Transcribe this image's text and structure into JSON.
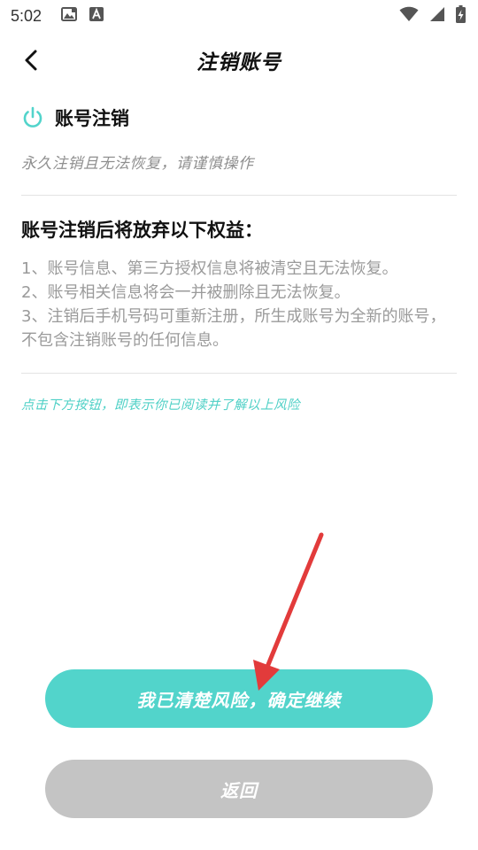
{
  "status_bar": {
    "time": "5:02",
    "left_icons": [
      "image-icon",
      "font-a-icon"
    ],
    "right_icons": [
      "wifi-icon",
      "signal-icon",
      "battery-charging-icon"
    ]
  },
  "header": {
    "title": "注销账号",
    "back_icon": "chevron-left-icon"
  },
  "section": {
    "icon": "power-icon",
    "title": "账号注销",
    "subtitle": "永久注销且无法恢复，请谨慎操作"
  },
  "rights": {
    "title": "账号注销后将放弃以下权益：",
    "items": [
      "1、账号信息、第三方授权信息将被清空且无法恢复。",
      "2、账号相关信息将会一并被删除且无法恢复。",
      "3、注销后手机号码可重新注册，所生成账号为全新的账号，不包含注销账号的任何信息。"
    ]
  },
  "notice": "点击下方按钮，即表示你已阅读并了解以上风险",
  "buttons": {
    "confirm_label": "我已清楚风险，确定继续",
    "back_label": "返回"
  },
  "colors": {
    "accent": "#52d4cb",
    "notice_text": "#4ed0c6",
    "disabled_button": "#c4c4c4",
    "annotation_arrow": "#e23b3b"
  }
}
